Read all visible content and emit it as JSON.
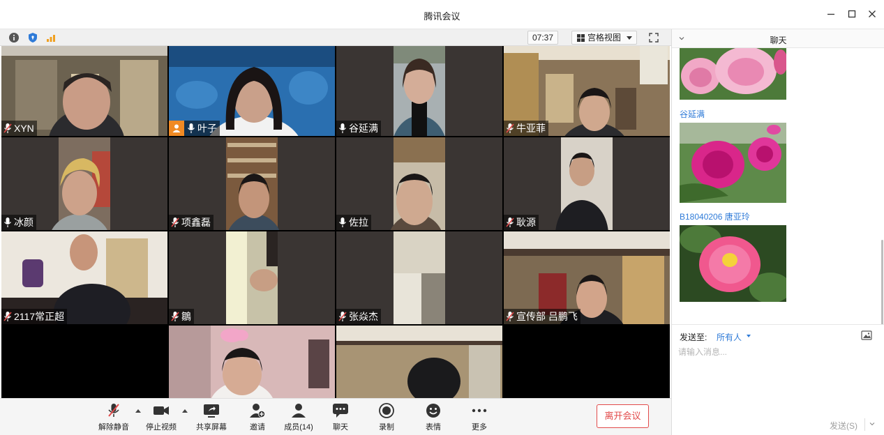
{
  "window": {
    "title": "腾讯会议"
  },
  "meeting_bar": {
    "timer": "07:37",
    "view_mode": "宫格视图"
  },
  "participants": [
    {
      "name": "XYN",
      "mic": "muted"
    },
    {
      "name": "叶子",
      "mic": "on",
      "avatar": true
    },
    {
      "name": "谷延满",
      "mic": "on"
    },
    {
      "name": "牛亚菲",
      "mic": "muted"
    },
    {
      "name": "冰颜",
      "mic": "on"
    },
    {
      "name": "项鑫磊",
      "mic": "muted"
    },
    {
      "name": "佐拉",
      "mic": "on"
    },
    {
      "name": "耿源",
      "mic": "muted"
    },
    {
      "name": "2117常正超",
      "mic": "muted"
    },
    {
      "name": "鶵",
      "mic": "muted"
    },
    {
      "name": "张焱杰",
      "mic": "muted"
    },
    {
      "name": "宣传部 吕鹏飞",
      "mic": "muted"
    },
    {
      "name": "",
      "mic": "none"
    },
    {
      "name": "",
      "mic": "none"
    },
    {
      "name": "",
      "mic": "none"
    }
  ],
  "toolbar": {
    "unmute": "解除静音",
    "stop_video": "停止视频",
    "share_screen": "共享屏幕",
    "invite": "邀请",
    "members": "成员(14)",
    "chat": "聊天",
    "record": "录制",
    "reactions": "表情",
    "more": "更多",
    "leave": "离开会议"
  },
  "chat": {
    "title": "聊天",
    "messages": [
      {
        "sender": "",
        "content": "peony-image-light-pink"
      },
      {
        "sender": "谷延满",
        "content": "peony-image-magenta"
      },
      {
        "sender": "B18040206 唐亚玲",
        "content": "peony-image-pink"
      }
    ],
    "send_to_label": "发送至:",
    "recipient": "所有人",
    "input_placeholder": "请输入消息...",
    "send_button": "发送(S)"
  },
  "colors": {
    "accent_blue": "#2f7bd8",
    "leave_red": "#e24a4a",
    "active_speaker_green": "#2bb64a",
    "avatar_orange": "#f08a24"
  }
}
